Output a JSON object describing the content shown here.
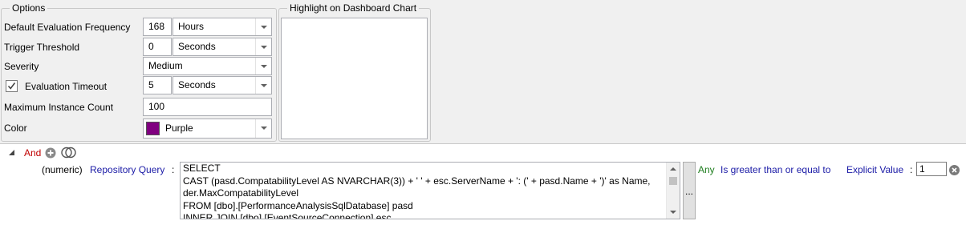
{
  "options": {
    "title": "Options",
    "default_eval_freq": {
      "label": "Default Evaluation Frequency",
      "value": "168",
      "unit": "Hours"
    },
    "trigger_threshold": {
      "label": "Trigger Threshold",
      "value": "0",
      "unit": "Seconds"
    },
    "severity": {
      "label": "Severity",
      "value": "Medium"
    },
    "eval_timeout": {
      "label": "Evaluation Timeout",
      "checked": true,
      "value": "5",
      "unit": "Seconds"
    },
    "max_instance": {
      "label": "Maximum Instance Count",
      "value": "100"
    },
    "color": {
      "label": "Color",
      "value": "Purple",
      "swatch": "#800080"
    }
  },
  "highlight": {
    "title": "Highlight on Dashboard Chart"
  },
  "condition": {
    "operator": "And",
    "type_label": "(numeric)",
    "source_label": "Repository Query",
    "colon": ":",
    "query_lines": [
      "SELECT",
      "CAST (pasd.CompatabilityLevel AS NVARCHAR(3)) + ' ' + esc.ServerName  + ': (' + pasd.Name + ')' as Name,",
      "der.MaxCompatabilityLevel",
      "FROM [dbo].[PerformanceAnalysisSqlDatabase] pasd",
      "INNER JOIN [dbo].[EventSourceConnection] esc"
    ],
    "ellipsis": "...",
    "any": "Any",
    "comparison": "Is greater than or equal to",
    "value_kind": "Explicit Value",
    "value_colon": ":",
    "value": "1"
  },
  "colors": {
    "and": "#c00000",
    "link": "#1a1aa6",
    "any": "#1e7d1e"
  }
}
